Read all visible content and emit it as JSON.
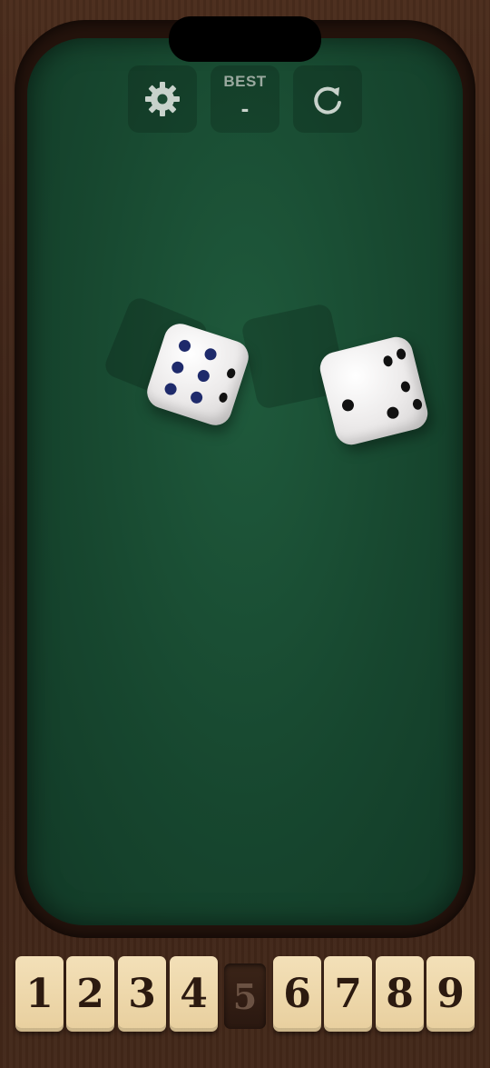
{
  "header": {
    "best_label": "BEST",
    "best_value": "-"
  },
  "icons": {
    "settings": "gear-icon",
    "restart": "refresh-icon"
  },
  "dice": [
    {
      "face": 6,
      "pip_color": "#1e2a6b"
    },
    {
      "face": 2,
      "pip_color": "#111111"
    }
  ],
  "tiles": [
    {
      "label": "1",
      "shut": false
    },
    {
      "label": "2",
      "shut": false
    },
    {
      "label": "3",
      "shut": false
    },
    {
      "label": "4",
      "shut": false
    },
    {
      "label": "5",
      "shut": true
    },
    {
      "label": "6",
      "shut": false
    },
    {
      "label": "7",
      "shut": false
    },
    {
      "label": "8",
      "shut": false
    },
    {
      "label": "9",
      "shut": false
    }
  ],
  "colors": {
    "felt": "#17472f",
    "wood": "#3a2216",
    "tile": "#f3e0b8"
  }
}
